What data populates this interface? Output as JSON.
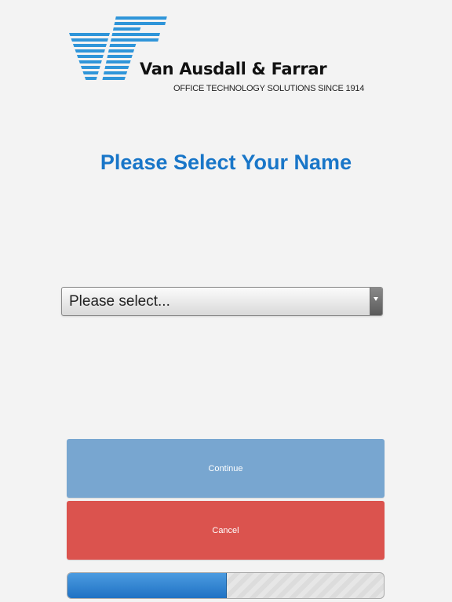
{
  "brand": {
    "company_name": "Van Ausdall & Farrar",
    "tagline": "OFFICE TECHNOLOGY SOLUTIONS SINCE 1914",
    "logo_icon": "vf-logo-icon",
    "logo_color": "#2f95d9"
  },
  "title": "Please Select Your Name",
  "name_select": {
    "selected_value": "Please select...",
    "arrow_icon": "chevron-down-icon"
  },
  "buttons": {
    "continue_label": "Continue",
    "cancel_label": "Cancel",
    "continue_color": "#78a6d0",
    "cancel_color": "#db534e"
  },
  "progress": {
    "fraction": 0.5,
    "fill_color": "#2a7fd0"
  },
  "colors": {
    "title": "#1976c8",
    "background": "#f3f3f3"
  }
}
